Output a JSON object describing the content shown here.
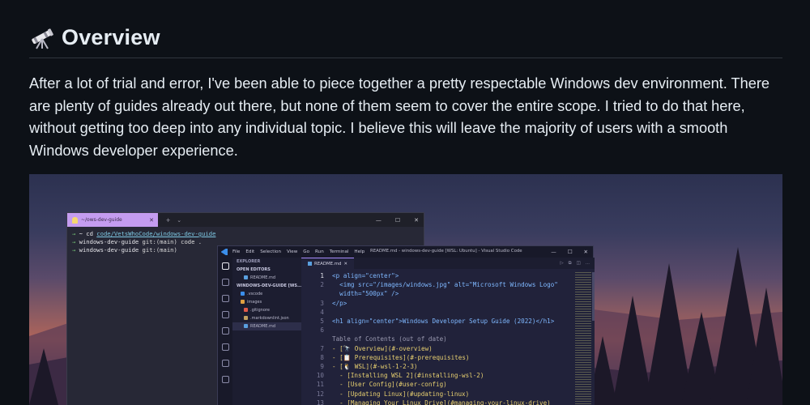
{
  "section": {
    "icon": "telescope-icon",
    "title": "Overview",
    "paragraph": "After a lot of trial and error, I've been able to piece together a pretty respectable Windows dev environment. There are plenty of guides already out there, but none of them seem to cover the entire scope. I tried to do that here, without getting too deep into any individual topic. I believe this will leave the majority of users with a smooth Windows developer experience."
  },
  "screenshot": {
    "terminal": {
      "tab_label": "~/ows-dev-guide",
      "lines": [
        {
          "prompt": "→",
          "text1": "~ cd ",
          "path": "code/VetsWhoCode/windows-dev-guide",
          "rest": ""
        },
        {
          "prompt": "→",
          "text1": "windows-dev-guide ",
          "path": "",
          "rest": "git:(main) code ."
        },
        {
          "prompt": "→",
          "text1": "windows-dev-guide ",
          "path": "",
          "rest": "git:(main)"
        }
      ]
    },
    "vscode": {
      "menu": [
        "File",
        "Edit",
        "Selection",
        "View",
        "Go",
        "Run",
        "Terminal",
        "Help"
      ],
      "window_title": "README.md - windows-dev-guide [WSL: Ubuntu] - Visual Studio Code",
      "explorer": {
        "header": "EXPLORER",
        "open_editors": "OPEN EDITORS",
        "open_file": "README.md",
        "folder": "WINDOWS-DEV-GUIDE [WS...",
        "items": [
          ".vscode",
          "images",
          ".gitignore",
          ".markdownlint.json",
          "README.md"
        ]
      },
      "tab": "README.md",
      "lines": [
        {
          "n": "1",
          "code": "<p align=\"center\">"
        },
        {
          "n": "2",
          "code": "  <img src=\"/images/windows.jpg\" alt=\"Microsoft Windows Logo\""
        },
        {
          "n": "",
          "code": "  width=\"500px\" />"
        },
        {
          "n": "3",
          "code": "</p>"
        },
        {
          "n": "4",
          "code": ""
        },
        {
          "n": "5",
          "code": "<h1 align=\"center\">Windows Developer Setup Guide (2022)</h1>"
        },
        {
          "n": "6",
          "code": ""
        },
        {
          "n": "",
          "code": "Table of Contents (out of date)"
        },
        {
          "n": "7",
          "code": "- [🔭 Overview](#-overview)"
        },
        {
          "n": "8",
          "code": "- [📋 Prerequisites](#-prerequisites)"
        },
        {
          "n": "9",
          "code": "- [🐧 WSL](#-wsl-1-2-3)"
        },
        {
          "n": "10",
          "code": "  - [Installing WSL 2](#installing-wsl-2)"
        },
        {
          "n": "11",
          "code": "  - [User Config](#user-config)"
        },
        {
          "n": "12",
          "code": "  - [Updating Linux](#updating-linux)"
        },
        {
          "n": "13",
          "code": "  - [Managing Your Linux Drive](#managing-your-linux-drive)"
        }
      ]
    }
  }
}
